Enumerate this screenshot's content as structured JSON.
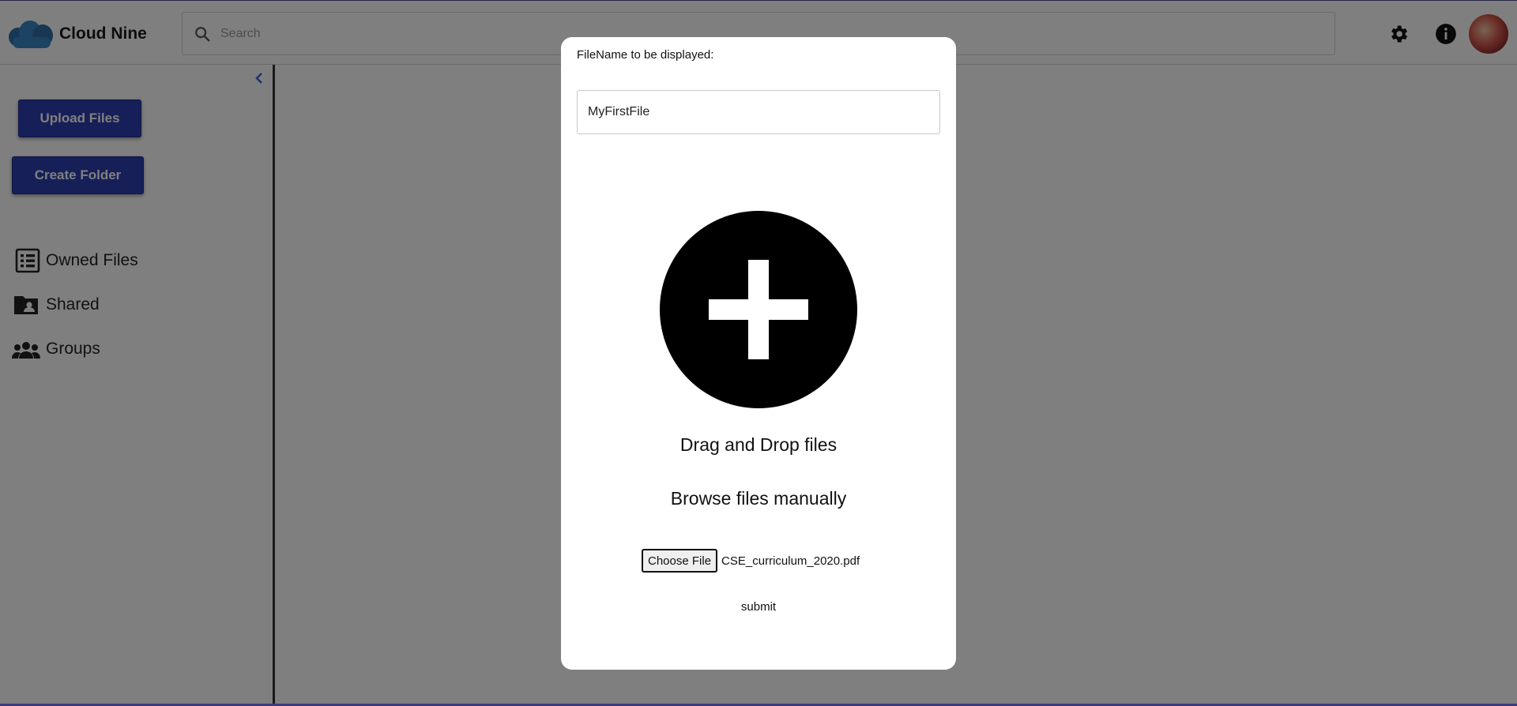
{
  "app": {
    "brand": "Cloud Nine"
  },
  "search": {
    "placeholder": "Search"
  },
  "sidebar": {
    "upload_label": "Upload Files",
    "create_folder_label": "Create Folder",
    "items": [
      {
        "label": "Owned Files",
        "icon": "list-icon"
      },
      {
        "label": "Shared",
        "icon": "shared-folder-icon"
      },
      {
        "label": "Groups",
        "icon": "groups-icon"
      }
    ]
  },
  "header": {
    "icons": [
      "settings-icon",
      "info-icon",
      "avatar"
    ]
  },
  "modal": {
    "filename_label": "FileName to be displayed:",
    "filename_value": "MyFirstFile",
    "drag_drop_text": "Drag and Drop files",
    "browse_text": "Browse files manually",
    "choose_file_label": "Choose File",
    "selected_file": "CSE_curriculum_2020.pdf",
    "submit_label": "submit"
  },
  "colors": {
    "primary_button": "#2e3fb3",
    "overlay": "rgba(0,0,0,0.5)"
  }
}
